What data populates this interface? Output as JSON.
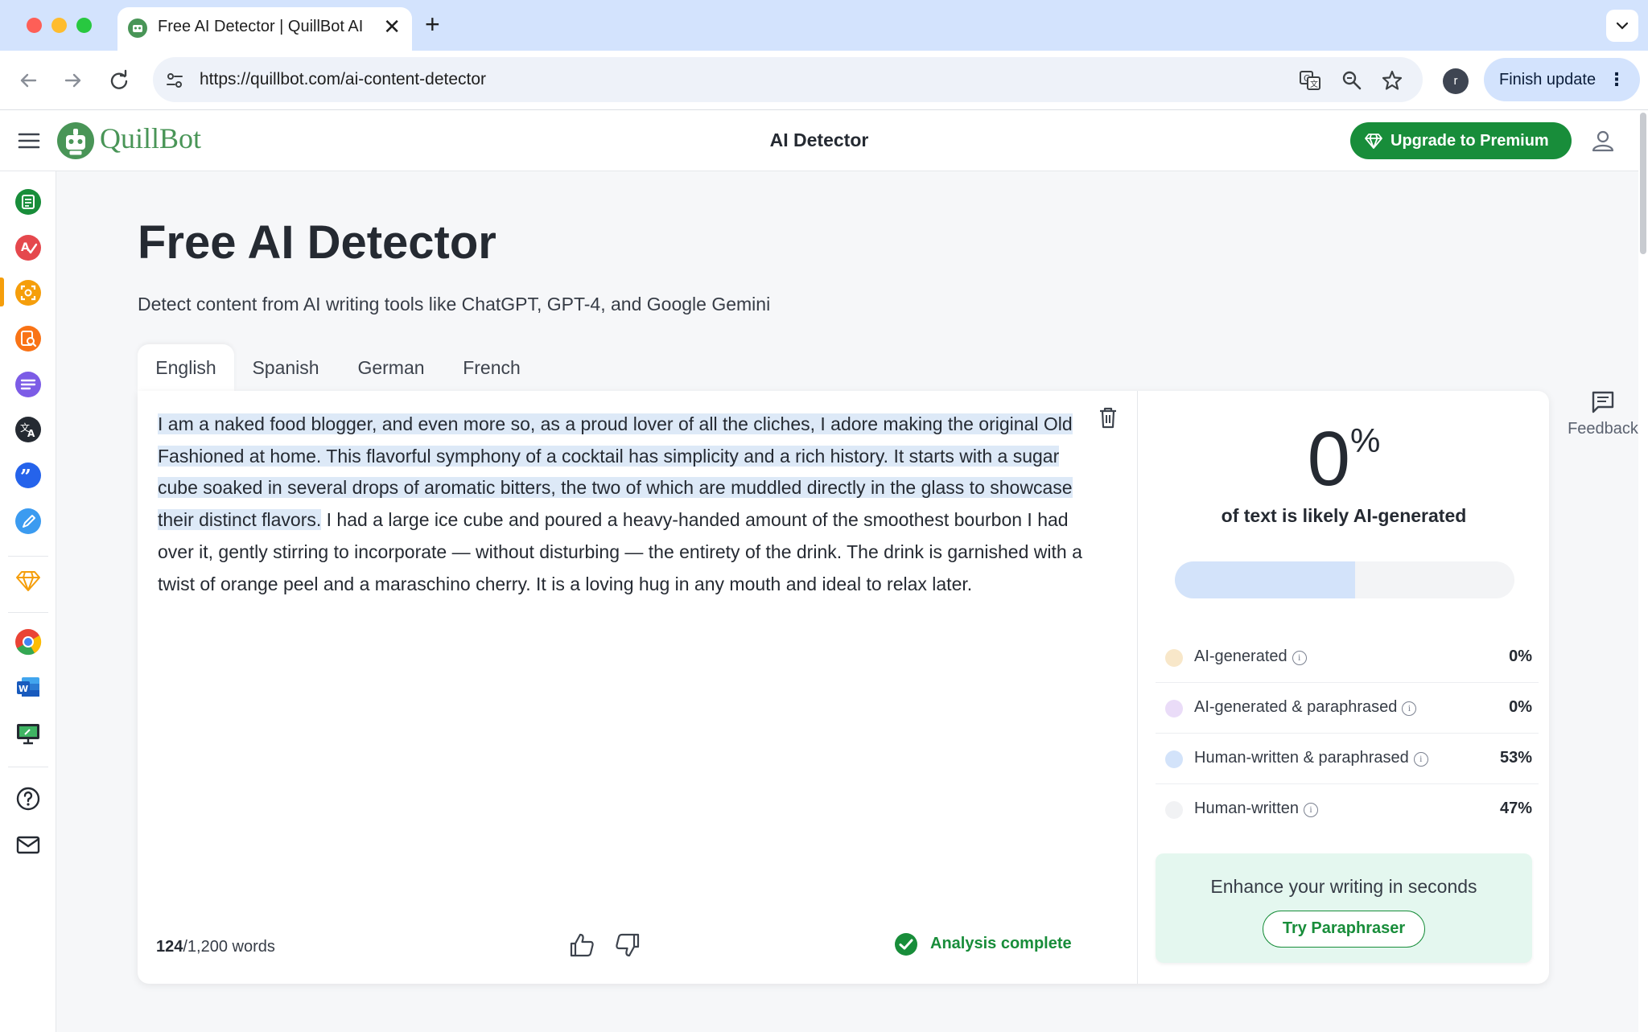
{
  "browser": {
    "tab_title": "Free AI Detector | QuillBot AI",
    "tab_close": "✕",
    "new_tab": "+",
    "url": "https://quillbot.com/ai-content-detector",
    "profile_initial": "r",
    "finish_update": "Finish update",
    "menu_dots": "⋮"
  },
  "app": {
    "logo_text": "QuillBot",
    "header_title": "AI Detector",
    "upgrade_label": "Upgrade to Premium",
    "brand_green": "#188d3a"
  },
  "page": {
    "title": "Free AI Detector",
    "subtitle": "Detect content from AI writing tools like ChatGPT, GPT-4, and Google Gemini"
  },
  "languages": [
    "English",
    "Spanish",
    "German",
    "French"
  ],
  "editor": {
    "highlighted_text": "I am a naked food blogger, and even more so, as a proud lover of all the cliches, I adore making the original Old Fashioned at home. This flavorful symphony of a cocktail has simplicity and a rich history. It starts with a sugar cube soaked in several drops of aromatic bitters, the two of which are muddled directly in the glass to showcase their distinct flavors.",
    "plain_text": " I had a large ice cube and poured a heavy-handed amount of the smoothest bourbon I had over it, gently stirring to incorporate — without disturbing — the entirety of the drink. The drink is garnished with a twist of orange peel and a maraschino cherry. It is a loving hug in any mouth and ideal to relax later.",
    "word_count": "124",
    "word_limit": "/1,200 words",
    "status": "Analysis complete"
  },
  "results": {
    "percent": "0",
    "percent_sign": "%",
    "label": "of text is likely AI-generated",
    "bar_fill_fraction": 0.53,
    "breakdown": [
      {
        "label": "AI-generated",
        "value": "0%",
        "color": "#f8e7c9"
      },
      {
        "label": "AI-generated & paraphrased",
        "value": "0%",
        "color": "#eadcf8"
      },
      {
        "label": "Human-written & paraphrased",
        "value": "53%",
        "color": "#d3e3fa"
      },
      {
        "label": "Human-written",
        "value": "47%",
        "color": "#f1f2f4"
      }
    ],
    "info_glyph": "i",
    "promo_text": "Enhance your writing in seconds",
    "promo_button": "Try Paraphraser"
  },
  "feedback": {
    "label": "Feedback"
  },
  "rail_icons": [
    "paraphraser-icon",
    "grammar-checker-icon",
    "ai-detector-icon",
    "plagiarism-checker-icon",
    "summarizer-icon",
    "translator-icon",
    "citation-generator-icon",
    "ai-writer-icon",
    "premium-icon",
    "chrome-extension-icon",
    "word-addin-icon",
    "desktop-app-icon",
    "help-icon",
    "contact-icon"
  ]
}
